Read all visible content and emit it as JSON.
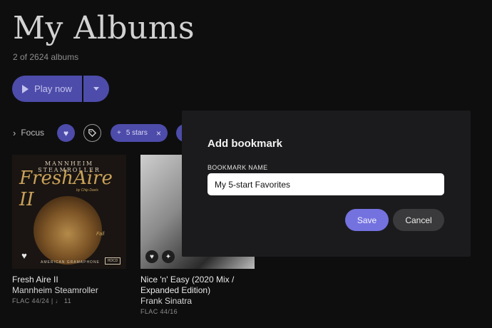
{
  "page": {
    "title": "My Albums",
    "subtitle": "2 of 2624 albums"
  },
  "actions": {
    "play_label": "Play now"
  },
  "focus": {
    "label": "Focus",
    "chips": [
      {
        "icon": "heart-icon"
      },
      {
        "icon": "tag-icon"
      },
      {
        "label": "5 stars",
        "icon": "plus-icon"
      }
    ]
  },
  "albums": [
    {
      "title": "Fresh Aire II",
      "artist": "Mannheim Steamroller",
      "meta": "FLAC 44/24 | ♩ 11",
      "cover_text": {
        "band": "MANNHEIM STEAMROLLER",
        "art_title": "FreshAire II",
        "by_line": "by Chip Davis",
        "season": "Fall",
        "label": "AMERICAN GRAMAPHONE",
        "badge": "HDCD"
      }
    },
    {
      "title": "Nice 'n' Easy (2020 Mix / Expanded Edition)",
      "artist": "Frank Sinatra",
      "meta": "FLAC 44/16"
    }
  ],
  "modal": {
    "title": "Add bookmark",
    "field_label": "BOOKMARK NAME",
    "field_value": "My 5-start Favorites",
    "save_label": "Save",
    "cancel_label": "Cancel"
  },
  "colors": {
    "accent": "#4d4caa",
    "save": "#7472df",
    "background": "#0e0e0f"
  }
}
